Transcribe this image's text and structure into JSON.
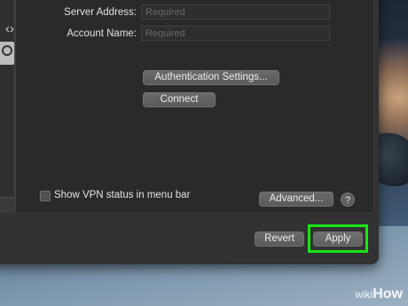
{
  "form": {
    "server_address": {
      "label": "Server Address:",
      "placeholder": "Required"
    },
    "account_name": {
      "label": "Account Name:",
      "placeholder": "Required"
    }
  },
  "buttons": {
    "authentication_settings": "Authentication Settings...",
    "connect": "Connect",
    "advanced": "Advanced...",
    "help": "?",
    "revert": "Revert",
    "apply": "Apply"
  },
  "options": {
    "show_vpn_status": {
      "label": "Show VPN status in menu bar",
      "checked": false
    }
  },
  "watermark": {
    "prefix": "wiki",
    "suffix": "How"
  },
  "colors": {
    "highlight": "#19e616",
    "window_bg": "#323232"
  }
}
